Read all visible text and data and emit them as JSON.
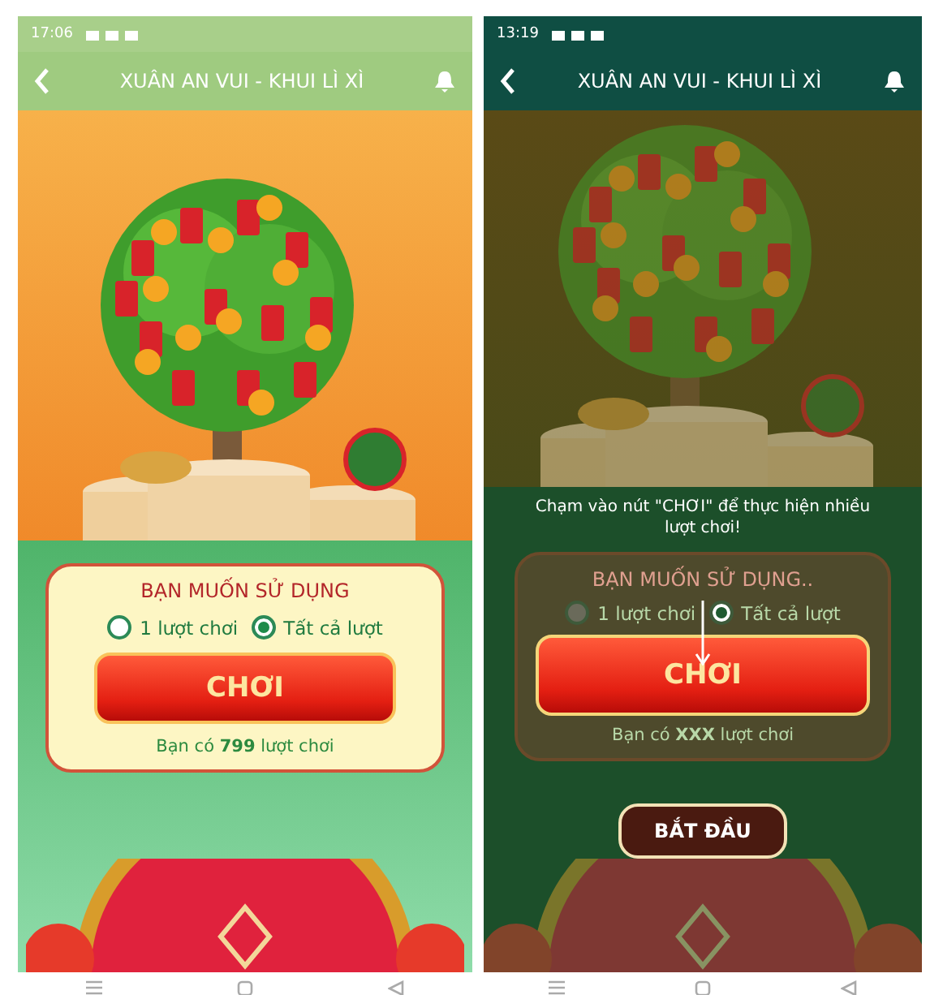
{
  "screens": [
    {
      "dimmed": false,
      "status_time": "17:06",
      "title": "XUÂN AN VUI - KHUI LÌ XÌ",
      "prompt": "BẠN MUỐN SỬ DỤNG",
      "options": [
        {
          "label": "1 lượt chơi",
          "selected": false
        },
        {
          "label": "Tất cả lượt",
          "selected": true
        }
      ],
      "play_button": "CHƠI",
      "count_text": "Bạn có **799** lượt chơi"
    },
    {
      "dimmed": true,
      "status_time": "13:19",
      "title": "XUÂN AN VUI - KHUI LÌ XÌ",
      "hint": "Chạm vào nút \"CHƠI\" để thực hiện nhiều lượt chơi!",
      "prompt": "BẠN MUỐN SỬ DỤNG..",
      "options": [
        {
          "label": "1 lượt chơi",
          "selected": false
        },
        {
          "label": "Tất cả lượt",
          "selected": true
        }
      ],
      "play_button": "CHƠI",
      "count_text": "Bạn có **XXX** lượt chơi",
      "start_button": "BẮT ĐẦU"
    }
  ]
}
